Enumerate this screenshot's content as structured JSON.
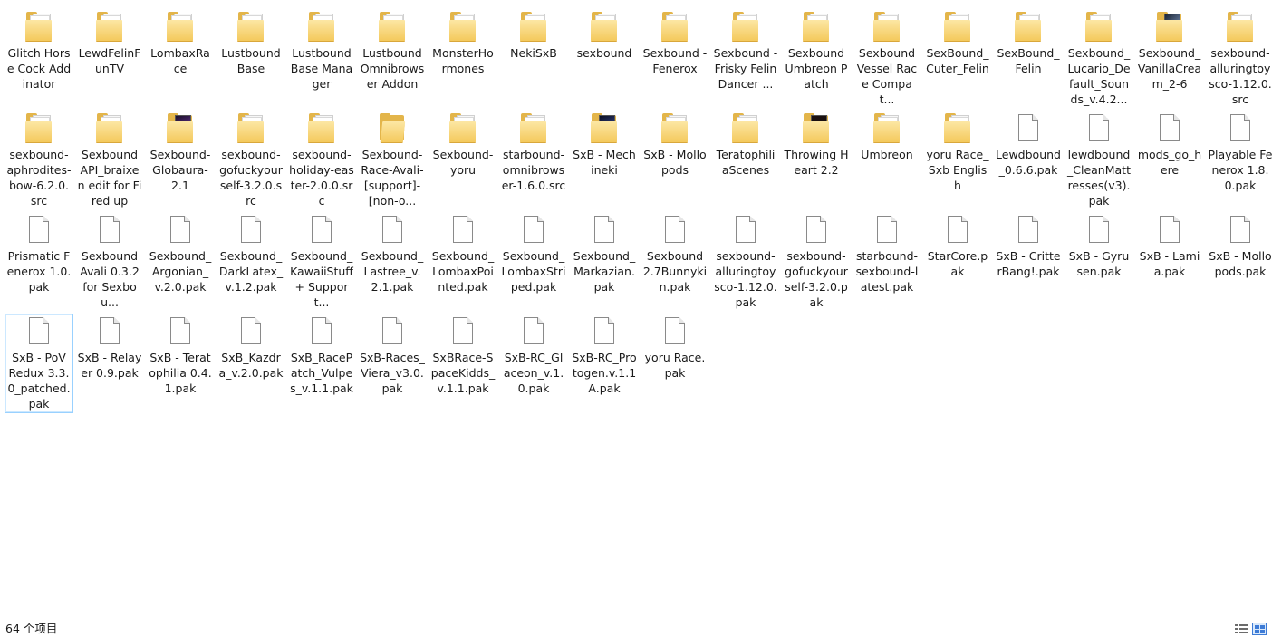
{
  "items": [
    {
      "name": "Glitch Horse Cock Addinator",
      "type": "folder"
    },
    {
      "name": "LewdFelinFunTV",
      "type": "folder"
    },
    {
      "name": "LombaxRace",
      "type": "folder"
    },
    {
      "name": "Lustbound Base",
      "type": "folder"
    },
    {
      "name": "Lustbound Base Manager",
      "type": "folder"
    },
    {
      "name": "Lustbound Omnibrowser Addon",
      "type": "folder"
    },
    {
      "name": "MonsterHormones",
      "type": "folder"
    },
    {
      "name": "NekiSxB",
      "type": "folder"
    },
    {
      "name": "sexbound",
      "type": "folder"
    },
    {
      "name": "Sexbound - Fenerox",
      "type": "folder"
    },
    {
      "name": "Sexbound - Frisky Felin Dancer ...",
      "type": "folder"
    },
    {
      "name": "Sexbound Umbreon Patch",
      "type": "folder"
    },
    {
      "name": "Sexbound Vessel Race Compat...",
      "type": "folder"
    },
    {
      "name": "SexBound_Cuter_Felin",
      "type": "folder"
    },
    {
      "name": "SexBound_Felin",
      "type": "folder"
    },
    {
      "name": "Sexbound_Lucario_Default_Sounds_v.4.2...",
      "type": "folder"
    },
    {
      "name": "Sexbound_VanillaCream_2-6",
      "type": "folder-thumb",
      "thumb": "dark-blue"
    },
    {
      "name": "sexbound-alluringtoysco-1.12.0.src",
      "type": "folder"
    },
    {
      "name": "sexbound-aphrodites-bow-6.2.0.src",
      "type": "folder"
    },
    {
      "name": "Sexbound API_braixen edit for Fired up",
      "type": "folder"
    },
    {
      "name": "Sexbound-Globaura-2.1",
      "type": "folder-thumb",
      "thumb": "purple"
    },
    {
      "name": "sexbound-gofuckyourself-3.2.0.src",
      "type": "folder"
    },
    {
      "name": "sexbound-holiday-easter-2.0.0.src",
      "type": "folder"
    },
    {
      "name": "Sexbound-Race-Avali-[support]-[non-o...",
      "type": "folder-empty"
    },
    {
      "name": "Sexbound-yoru",
      "type": "folder"
    },
    {
      "name": "starbound-omnibrowser-1.6.0.src",
      "type": "folder"
    },
    {
      "name": "SxB - Mechineki",
      "type": "folder-thumb",
      "thumb": "navy"
    },
    {
      "name": "SxB - Mollopods",
      "type": "folder"
    },
    {
      "name": "TeratophiliaScenes",
      "type": "folder"
    },
    {
      "name": "Throwing Heart 2.2",
      "type": "folder-thumb",
      "thumb": "redblack"
    },
    {
      "name": "Umbreon",
      "type": "folder"
    },
    {
      "name": "yoru Race_Sxb English",
      "type": "folder"
    },
    {
      "name": "Lewdbound_0.6.6.pak",
      "type": "file"
    },
    {
      "name": "lewdbound_CleanMattresses(v3).pak",
      "type": "file"
    },
    {
      "name": "mods_go_here",
      "type": "file"
    },
    {
      "name": "Playable Fenerox 1.8.0.pak",
      "type": "file"
    },
    {
      "name": "Prismatic Fenerox 1.0.pak",
      "type": "file"
    },
    {
      "name": "Sexbound Avali 0.3.2 for Sexbou...",
      "type": "file"
    },
    {
      "name": "Sexbound_Argonian_v.2.0.pak",
      "type": "file"
    },
    {
      "name": "Sexbound_DarkLatex_v.1.2.pak",
      "type": "file"
    },
    {
      "name": "Sexbound_KawaiiStuff+ Support...",
      "type": "file"
    },
    {
      "name": "Sexbound_Lastree_v.2.1.pak",
      "type": "file"
    },
    {
      "name": "Sexbound_LombaxPointed.pak",
      "type": "file"
    },
    {
      "name": "Sexbound_LombaxStriped.pak",
      "type": "file"
    },
    {
      "name": "Sexbound_Markazian.pak",
      "type": "file"
    },
    {
      "name": "Sexbound 2.7Bunnykin.pak",
      "type": "file"
    },
    {
      "name": "sexbound-alluringtoysco-1.12.0.pak",
      "type": "file"
    },
    {
      "name": "sexbound-gofuckyourself-3.2.0.pak",
      "type": "file"
    },
    {
      "name": "starbound-sexbound-latest.pak",
      "type": "file"
    },
    {
      "name": "StarCore.pak",
      "type": "file"
    },
    {
      "name": "SxB - CritterBang!.pak",
      "type": "file"
    },
    {
      "name": "SxB - Gyrusen.pak",
      "type": "file"
    },
    {
      "name": "SxB - Lamia.pak",
      "type": "file"
    },
    {
      "name": "SxB - Mollopods.pak",
      "type": "file"
    },
    {
      "name": "SxB - PoV Redux 3.3.0_patched.pak",
      "type": "file",
      "selected": true
    },
    {
      "name": "SxB - Relayer 0.9.pak",
      "type": "file"
    },
    {
      "name": "SxB - Teratophilia 0.4.1.pak",
      "type": "file"
    },
    {
      "name": "SxB_Kazdra_v.2.0.pak",
      "type": "file"
    },
    {
      "name": "SxB_RacePatch_Vulpes_v.1.1.pak",
      "type": "file"
    },
    {
      "name": "SxB-Races_Viera_v3.0.pak",
      "type": "file"
    },
    {
      "name": "SxBRace-SpaceKidds_v.1.1.pak",
      "type": "file"
    },
    {
      "name": "SxB-RC_Glaceon_v.1.0.pak",
      "type": "file"
    },
    {
      "name": "SxB-RC_Protogen.v.1.1A.pak",
      "type": "file"
    },
    {
      "name": "yoru Race.pak",
      "type": "file"
    }
  ],
  "status": {
    "item_count": "64 个项目"
  },
  "view": {
    "details_icon": "details-view-icon",
    "large_icon": "large-icons-view-icon",
    "active": "large-icons"
  }
}
